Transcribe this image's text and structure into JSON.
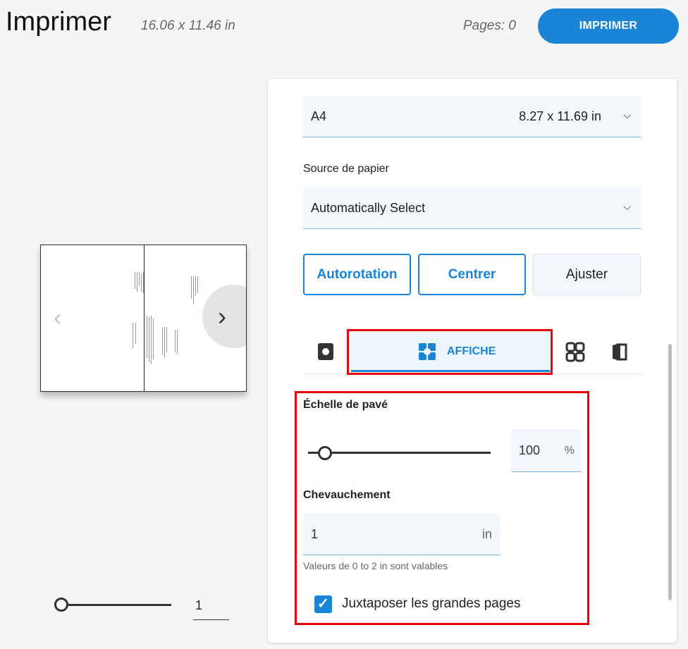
{
  "header": {
    "title": "Imprimer",
    "dimensions": "16.06 x 11.46 in",
    "pages": "Pages: 0",
    "print_label": "IMPRIMER"
  },
  "preview": {
    "prev_icon": "chevron-left-icon",
    "next_icon": "chevron-right-icon",
    "zoom_value": "1"
  },
  "panel": {
    "paper_size": {
      "label": "A4",
      "value": "8.27 x 11.69 in"
    },
    "paper_source": {
      "label": "Source de papier",
      "value": "Automatically Select"
    },
    "buttons": {
      "autorotate": "Autorotation",
      "center": "Centrer",
      "fit": "Ajuster"
    },
    "tabs": {
      "single_icon": "single-page-icon",
      "poster_label": "AFFICHE",
      "poster_icon": "poster-icon",
      "multiple_icon": "multiple-pages-icon",
      "booklet_icon": "booklet-icon"
    },
    "tile_scale": {
      "label": "Échelle de pavé",
      "value": "100",
      "unit": "%",
      "slider_fraction": 0.08
    },
    "overlap": {
      "label": "Chevauchement",
      "value": "1",
      "unit": "in",
      "hint": "Valeurs de 0 to 2 in sont valables"
    },
    "juxtapose": {
      "label": "Juxtaposer les grandes pages",
      "checked": true
    }
  },
  "colors": {
    "accent": "#1a85d6",
    "highlight": "#e8000b"
  }
}
